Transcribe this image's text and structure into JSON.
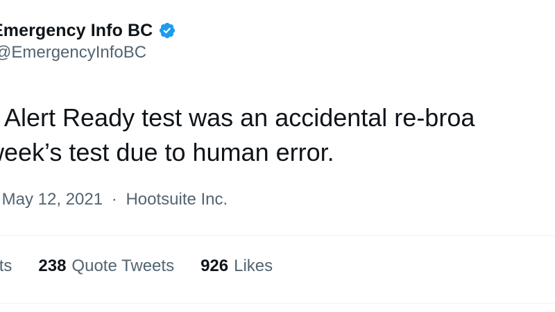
{
  "tweet": {
    "display_name": "Emergency Info BC",
    "handle": "@EmergencyInfoBC",
    "verified_icon": "verified-badge-icon",
    "body_lines": [
      "s Alert Ready test was an accidental re-broa",
      "week’s test due to human error."
    ],
    "meta": {
      "leading_dot": "·",
      "date": "May 12, 2021",
      "separator": "·",
      "source": "Hootsuite Inc."
    },
    "stats": {
      "retweets_label": "eets",
      "quote_tweets_count": "238",
      "quote_tweets_label": "Quote Tweets",
      "likes_count": "926",
      "likes_label": "Likes"
    }
  },
  "colors": {
    "text_primary": "#0f1419",
    "text_secondary": "#536471",
    "verified_blue": "#1d9bf0",
    "divider": "#eff3f4"
  }
}
